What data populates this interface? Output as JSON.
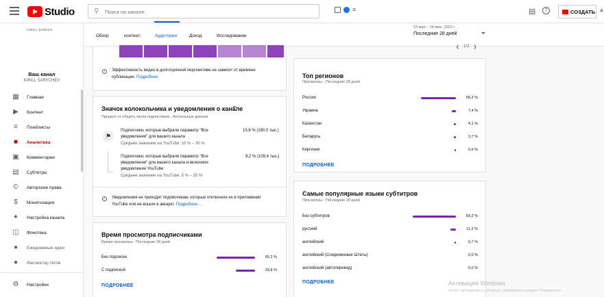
{
  "topbar": {
    "logo_text": "Studio",
    "search_placeholder": "Поиск на канале",
    "create_label": "СОЗДАТЬ",
    "accent": "#ff0000"
  },
  "sidebar": {
    "channel_logo_text": "KIRILL SARYCH",
    "channel_title": "Ваш канал",
    "channel_name": "KIRILL SARYCHEV",
    "items": [
      {
        "label": "Главная",
        "icon": "dashboard-icon"
      },
      {
        "label": "Контент",
        "icon": "content-icon"
      },
      {
        "label": "Плейлисты",
        "icon": "playlists-icon"
      },
      {
        "label": "Аналитика",
        "icon": "analytics-icon",
        "active": true
      },
      {
        "label": "Комментарии",
        "icon": "comments-icon"
      },
      {
        "label": "Субтитры",
        "icon": "subtitles-icon"
      },
      {
        "label": "Авторские права",
        "icon": "copyright-icon"
      },
      {
        "label": "Монетизация",
        "icon": "monetization-icon"
      },
      {
        "label": "Настройка канала",
        "icon": "customization-icon"
      },
      {
        "label": "Фонотека",
        "icon": "audio-library-icon"
      },
      {
        "label": "Ежедневные идеи",
        "icon": "ideas-icon"
      },
      {
        "label": "Инспектор тегов",
        "icon": "tags-icon"
      },
      {
        "label": "Настройки",
        "icon": "settings-icon"
      }
    ]
  },
  "tabs": [
    "Обзор",
    "контент;",
    "Аудитория",
    "Доход",
    "Исследование"
  ],
  "active_tab": "Аудитория",
  "date": {
    "range": "23 мая – 19 июн. 2022 г.",
    "selected": "Последние 28 дней",
    "pager": "1/3"
  },
  "retention_note": {
    "text": "Эффективность видео в долгосрочной перспективе не зависит от времени",
    "text2": "публикации.",
    "link": "Подробнее"
  },
  "bell": {
    "title": "Значок колокольчика и уведомления о канале",
    "subtitle": "Процент от общего числа подписчиков · Актуальные данные",
    "row1": {
      "line1": "Подписчики, которые выбрали параметр \"Все",
      "line2": "уведомления\" для вашего канала",
      "avg": "Среднее значение на YouTube: 10 % – 30 %",
      "value": "15,8 % (180,0 тыс.)"
    },
    "row2": {
      "line1": "Подписчики, которые выбрали параметр \"Все",
      "line2": "уведомления\" для вашего канала и включили",
      "line3": "уведомления YouTube",
      "avg": "Среднее значение на YouTube: 5 % – 20 %",
      "value": "9,2 % (109,4 тыс.)"
    },
    "note1": "Уведомления не приходят подписчикам, которые отключили их в приложении",
    "note2": "YouTube или не вошли в аккаунт.",
    "note_link": "Подробнее..."
  },
  "watch_subs": {
    "title": "Время просмотра подписчиками",
    "subtitle": "Время просмотра · Последние 28 дней",
    "rows": [
      {
        "label": "Без подписки",
        "value": "66,2 %",
        "fraction": 0.662
      },
      {
        "label": "С подпиской",
        "value": "33,8 %",
        "fraction": 0.338
      }
    ],
    "more": "ПОДРОБНЕЕ"
  },
  "regions": {
    "title": "Топ регионов",
    "subtitle": "Просмотры · Последние 28 дней",
    "rows": [
      {
        "label": "Россия",
        "value": "68,2 %",
        "fraction": 0.682
      },
      {
        "label": "Украина",
        "value": "7,4 %",
        "fraction": 0.074
      },
      {
        "label": "Казахстан",
        "value": "4,1 %",
        "fraction": 0.041
      },
      {
        "label": "Беларусь",
        "value": "3,7 %",
        "fraction": 0.037
      },
      {
        "label": "Киргизия",
        "value": "0,9 %",
        "fraction": 0.009
      }
    ],
    "more": "ПОДРОБНЕЕ"
  },
  "subtitles": {
    "title": "Самые популярные языки субтитров",
    "subtitle": "Просмотры · Последние 28 дней",
    "rows": [
      {
        "label": "Без субтитров",
        "value": "83,2 %",
        "fraction": 0.832
      },
      {
        "label": "русский",
        "value": "11,2 %",
        "fraction": 0.112
      },
      {
        "label": "английский",
        "value": "0,7 %",
        "fraction": 0.007
      },
      {
        "label": "английский (Соединенные Штаты)",
        "value": "0,0 %",
        "fraction": 0.0
      },
      {
        "label": "английский (автоперевод)",
        "value": "0,0 %",
        "fraction": 0.0
      }
    ],
    "more": "ПОДРОБНЕЕ"
  },
  "watermark": {
    "line1": "Активация Windows",
    "line2": "Чтобы активировать Windows, перейдите в раздел \"Параметры\"."
  },
  "colors": {
    "bar": "#7b22ae",
    "link": "#065fd4",
    "active_nav": "#cc0000"
  }
}
